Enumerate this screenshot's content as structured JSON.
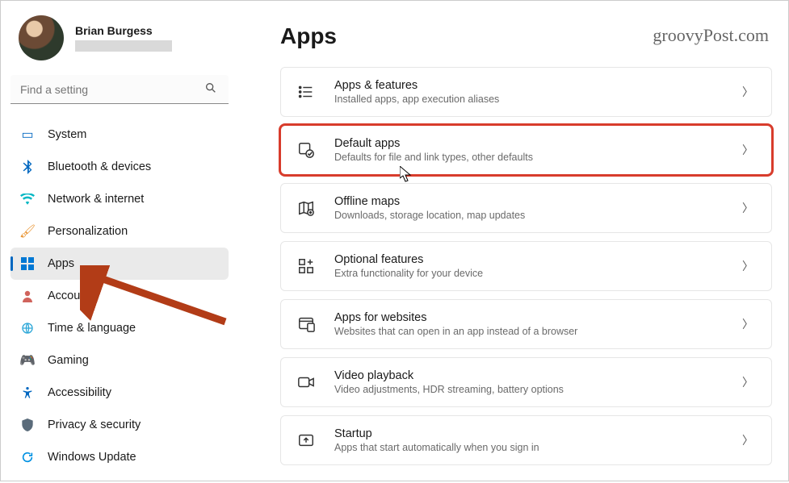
{
  "profile": {
    "name": "Brian Burgess"
  },
  "search": {
    "placeholder": "Find a setting"
  },
  "nav": [
    {
      "label": "System",
      "icon": "system",
      "color": "#0067c0"
    },
    {
      "label": "Bluetooth & devices",
      "icon": "bluetooth",
      "color": "#0067c0"
    },
    {
      "label": "Network & internet",
      "icon": "wifi",
      "color": "#00b7c3"
    },
    {
      "label": "Personalization",
      "icon": "brush",
      "color": "#e8912d"
    },
    {
      "label": "Apps",
      "icon": "apps",
      "color": "#0078d4",
      "active": true
    },
    {
      "label": "Accounts",
      "icon": "person",
      "color": "#d0635c"
    },
    {
      "label": "Time & language",
      "icon": "globe",
      "color": "#2ea8d8"
    },
    {
      "label": "Gaming",
      "icon": "gamepad",
      "color": "#7a7a7a"
    },
    {
      "label": "Accessibility",
      "icon": "accessibility",
      "color": "#0067c0"
    },
    {
      "label": "Privacy & security",
      "icon": "shield",
      "color": "#5a6b7a"
    },
    {
      "label": "Windows Update",
      "icon": "update",
      "color": "#0091e2"
    }
  ],
  "page": {
    "title": "Apps"
  },
  "cards": [
    {
      "title": "Apps & features",
      "subtitle": "Installed apps, app execution aliases",
      "icon": "list"
    },
    {
      "title": "Default apps",
      "subtitle": "Defaults for file and link types, other defaults",
      "icon": "default",
      "highlight": true
    },
    {
      "title": "Offline maps",
      "subtitle": "Downloads, storage location, map updates",
      "icon": "map"
    },
    {
      "title": "Optional features",
      "subtitle": "Extra functionality for your device",
      "icon": "optional"
    },
    {
      "title": "Apps for websites",
      "subtitle": "Websites that can open in an app instead of a browser",
      "icon": "websites"
    },
    {
      "title": "Video playback",
      "subtitle": "Video adjustments, HDR streaming, battery options",
      "icon": "video"
    },
    {
      "title": "Startup",
      "subtitle": "Apps that start automatically when you sign in",
      "icon": "startup"
    }
  ],
  "watermark": "groovyPost.com"
}
